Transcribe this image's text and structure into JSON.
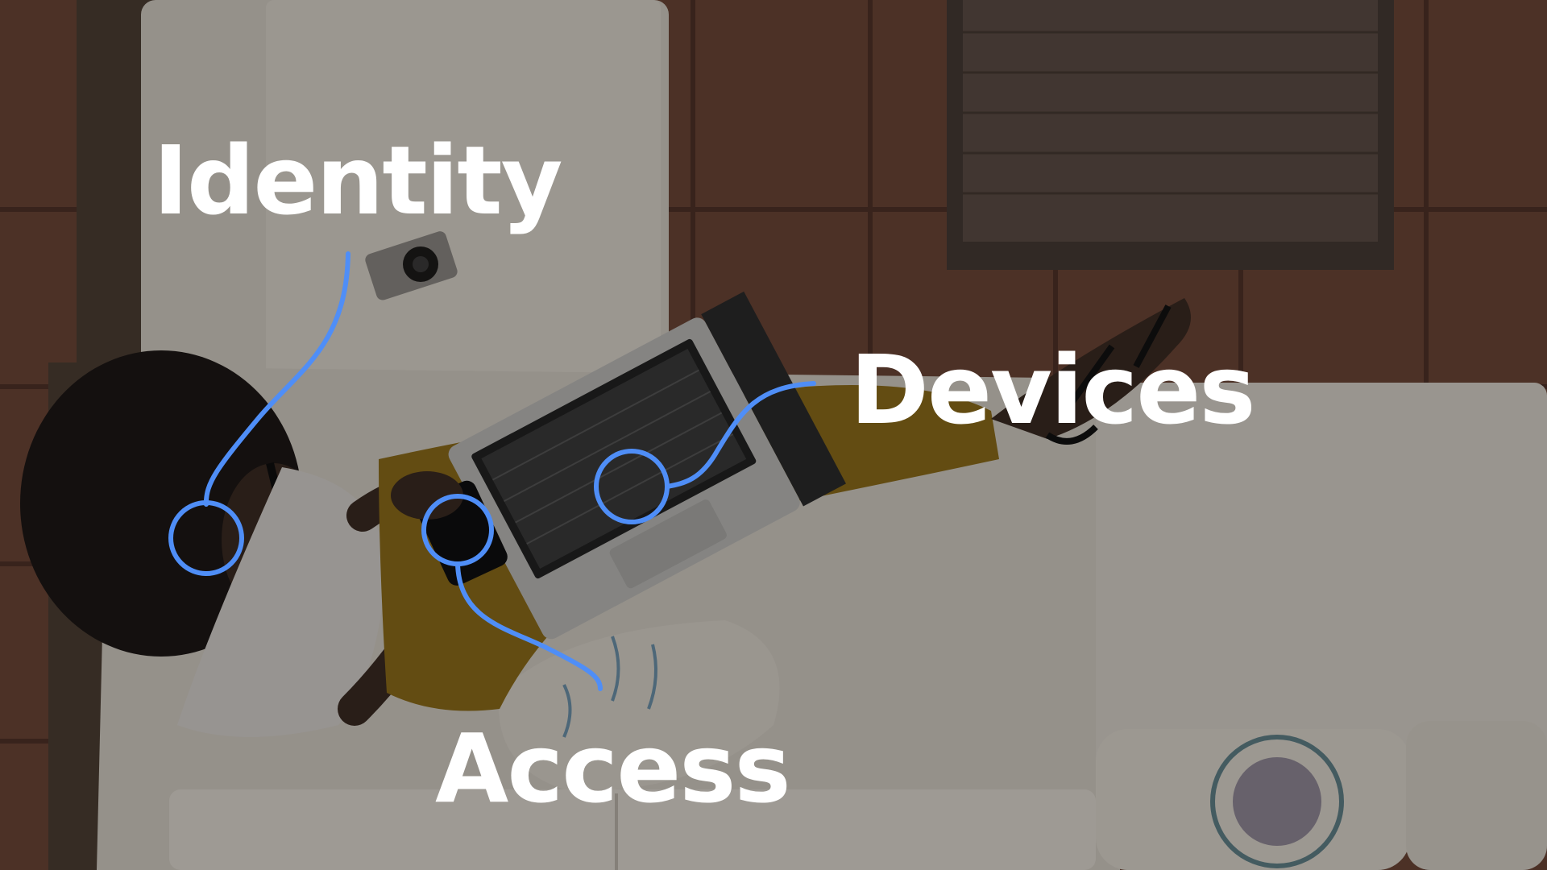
{
  "labels": {
    "identity": "Identity",
    "devices": "Devices",
    "access": "Access"
  },
  "colors": {
    "accent": "#4f8ef7",
    "text": "#ffffff"
  }
}
